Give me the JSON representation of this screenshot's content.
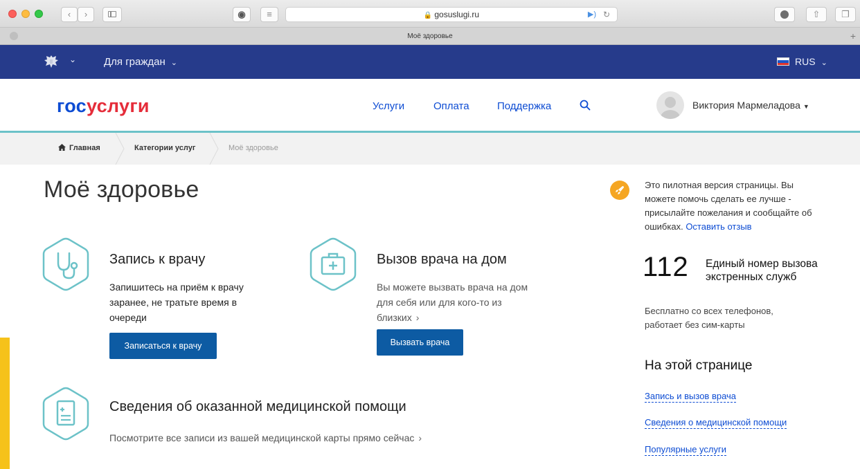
{
  "browser": {
    "url": "gosuslugi.ru",
    "tab_title": "Моё здоровье"
  },
  "gov_bar": {
    "citizens_menu": "Для граждан",
    "language": "RUS",
    "colors": {
      "background": "#263b8b"
    }
  },
  "header": {
    "logo_part1": "гос",
    "logo_part2": "услуги",
    "nav": {
      "services": "Услуги",
      "payment": "Оплата",
      "support": "Поддержка"
    },
    "user_name": "Виктория Мармеладова",
    "colors": {
      "accent_line": "#6cc2c8",
      "link": "#0d4cd3",
      "logo_red": "#e52d3a"
    }
  },
  "breadcrumb": {
    "home": "Главная",
    "categories": "Категории услуг",
    "current": "Моё здоровье"
  },
  "main": {
    "title": "Моё здоровье",
    "cards": {
      "appointment": {
        "title": "Запись к врачу",
        "text": "Запишитесь на приём к врачу заранее, не тратьте время в очереди",
        "button": "Записаться к врачу",
        "icon": "stethoscope-icon"
      },
      "home_visit": {
        "title": "Вызов врача на дом",
        "text": "Вы можете вызвать врача на дом для себя или для кого-то из близких",
        "button": "Вызвать врача",
        "icon": "first-aid-kit-icon"
      },
      "records": {
        "title": "Сведения об оказанной медицинской помощи",
        "text": "Посмотрите все записи из вашей медицинской карты прямо сейчас",
        "icon": "medical-record-icon"
      }
    },
    "colors": {
      "icon_teal": "#6cc2c8",
      "button_blue": "#0d5ba3"
    }
  },
  "sidebar": {
    "pilot_text": "Это пилотная версия страницы. Вы можете помочь сделать ее лучше - присылайте пожелания и сообщайте об ошибках.",
    "pilot_link": "Оставить отзыв",
    "emergency_number": "112",
    "emergency_title": "Единый номер вызова экстренных служб",
    "emergency_note": "Бесплатно со всех телефонов, работает без сим-карты",
    "on_page_title": "На этой странице",
    "on_page_links": [
      "Запись и вызов врача",
      "Сведения о медицинской помощи",
      "Популярные услуги"
    ],
    "colors": {
      "pilot_badge": "#f5a623"
    }
  }
}
